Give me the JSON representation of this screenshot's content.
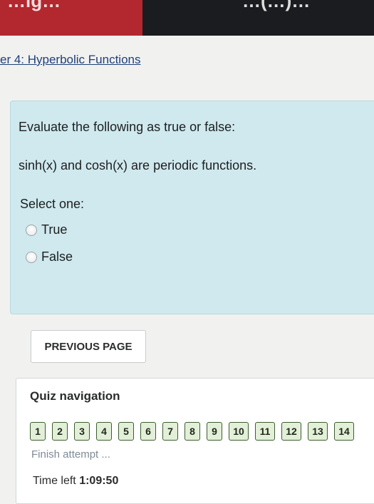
{
  "header": {
    "left_title_fragment": "…ig…",
    "right_title_fragment": "…(…)…"
  },
  "breadcrumb": "er 4: Hyperbolic Functions",
  "question": {
    "prompt": "Evaluate the following as true or false:",
    "statement": "sinh(x) and cosh(x) are periodic functions.",
    "select_label": "Select one:",
    "options": [
      {
        "label": "True",
        "selected": false
      },
      {
        "label": "False",
        "selected": false
      }
    ]
  },
  "actions": {
    "previous_label": "PREVIOUS PAGE"
  },
  "quiz_navigation": {
    "title": "Quiz navigation",
    "questions": [
      "1",
      "2",
      "3",
      "4",
      "5",
      "6",
      "7",
      "8",
      "9",
      "10",
      "11",
      "12",
      "13",
      "14"
    ],
    "finish_label": "Finish attempt ...",
    "time_left_label": "Time left",
    "time_left_value": "1:09:50"
  },
  "colors": {
    "top_bar_left": "#b3272f",
    "top_bar_right": "#1b1c1f",
    "question_card": "#cfe9ee",
    "nav_button_border": "#3d5e2f",
    "link": "#1f3f7a"
  }
}
